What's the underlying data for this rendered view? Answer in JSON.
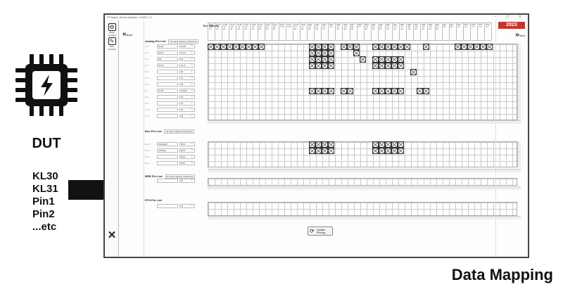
{
  "left": {
    "dut_label": "DUT",
    "pins": [
      "KL30",
      "KL31",
      "Pin1",
      "Pin2",
      "...etc"
    ]
  },
  "footer_title": "Data Mapping",
  "window": {
    "title": "PTStand_ServerHandler v.2023.1.3",
    "leftbar": {
      "btn1": "Read Contract",
      "btn2": "Edit Contract"
    },
    "back_label": "Back",
    "next_label": "Next",
    "brand": "2023",
    "test_names_label": "Test Names:",
    "test_headers": [
      "KL30 Y-1 vol.",
      "KL31 Y-1 vol.",
      "KL30 Y-2 dir",
      "KL31 Y-2 dir",
      "KL30 Y-3 ext",
      "KL31 Y-3 ext",
      "KL30 Y-4 ext",
      "KL31 Y-4 ext",
      "KL30 Y-5 Sd",
      "KL31 Y-5 Sd",
      "KL30 Y-6 3",
      "KL31 Y-6 3",
      "KL30 Y-7 Sd",
      "KL31 Y-7 Sd",
      "ED1 Y-1 Sd",
      "ED2 Y-1 Sd",
      "ED3 Y-2 Sd",
      "ED4 Y-2",
      "ED5 Y-3 Sd",
      "ED6 Y-3 Sd",
      "ED7 Y-4 Sd",
      "ED8 Y-4",
      "ED9 Y-5 Sd",
      "EE1 Y-5 Sd",
      "EE2 Y-6 Sd",
      "EE3 Y-6 mic",
      "EE4 Y-7 mic",
      "EE5 Y-7 mic",
      "EE6 Y-8 mic",
      "EE7 Y-8 Sd",
      "EE8 Y-9 Sd",
      "EE9 Y-9 Sd",
      "EF1 Y-1 Sd",
      "EF2 Sd",
      "EF3 Sd",
      "IPT1 Y-1",
      "IPT2 Y-1",
      "IPT3 Y-2",
      "IPT4 Y-2",
      "IPT5 Y-3"
    ],
    "analog_label": "Analog Pin List:",
    "analog_hint": "No name without underscore",
    "analog_pins": [
      {
        "id": "AI 0",
        "name": "KL30",
        "dir": "KL30"
      },
      {
        "id": "AI 1",
        "name": "KL31",
        "dir": "KL31"
      },
      {
        "id": "AI 2",
        "name": "IN1",
        "dir": "IN"
      },
      {
        "id": "AI 3",
        "name": "OUT1",
        "dir": "OUT"
      },
      {
        "id": "AI 4",
        "name": "",
        "dir": "IN"
      },
      {
        "id": "AI 5",
        "name": "",
        "dir": "IN"
      },
      {
        "id": "AI 6",
        "name": "",
        "dir": "IN"
      },
      {
        "id": "AI 7",
        "name": "KL15",
        "dir": "WAKE"
      },
      {
        "id": "AI 8",
        "name": "",
        "dir": "IN"
      },
      {
        "id": "AI 9",
        "name": "",
        "dir": "IN"
      },
      {
        "id": "AI 10",
        "name": "",
        "dir": "IN"
      },
      {
        "id": "AI 11",
        "name": "",
        "dir": "IN"
      }
    ],
    "bus_label": "Bus Pin List:",
    "bus_hint": "No name without underscore",
    "bus_pins": [
      {
        "id": "Bus 0",
        "name": "CANHigh",
        "dir": "BUS"
      },
      {
        "id": "Bus 1",
        "name": "CANlow",
        "dir": "BUS"
      },
      {
        "id": "Bus 2",
        "name": "",
        "dir": "BUS"
      },
      {
        "id": "Bus 3",
        "name": "",
        "dir": "BUS"
      }
    ],
    "brr_label": "BRR Pin List:",
    "brr_hint": "No name without underscore",
    "brr_pins": [
      {
        "id": "",
        "name": "",
        "dir": "IN"
      }
    ],
    "eth_label": "ETH Pin List:",
    "eth_pins": [
      {
        "id": "",
        "name": "",
        "dir": "IN"
      }
    ],
    "update_label": "Update Pinning",
    "colors": {
      "brand": "#c0392b",
      "grid": "#c9c9c9"
    }
  }
}
